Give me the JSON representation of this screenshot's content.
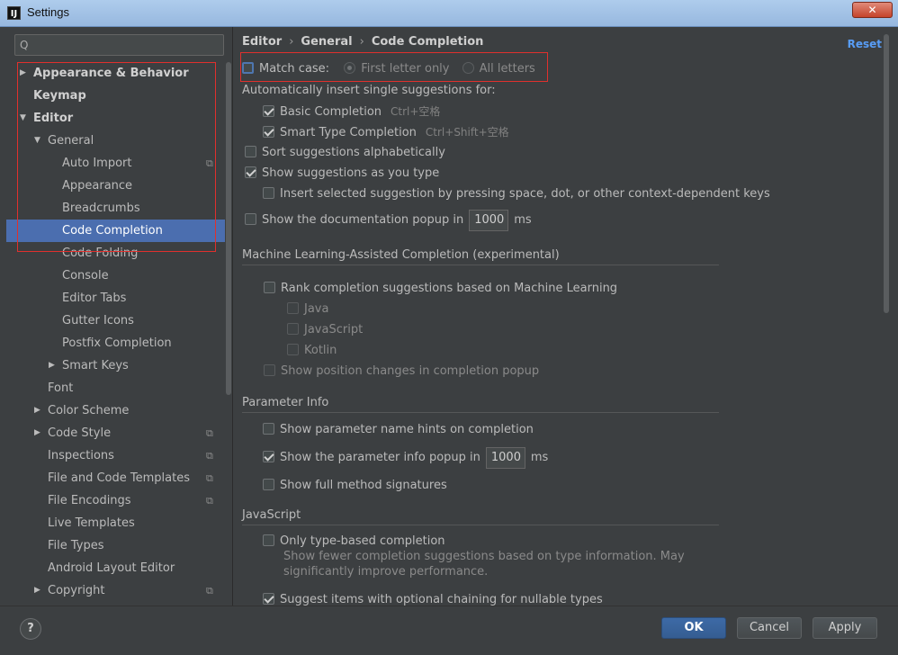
{
  "window": {
    "title": "Settings",
    "app_icon": "IJ",
    "close_glyph": "✕"
  },
  "search": {
    "placeholder": "",
    "icon": "Q"
  },
  "tree": [
    {
      "label": "Appearance & Behavior",
      "depth": 0,
      "arrow": "▶",
      "bold": true
    },
    {
      "label": "Keymap",
      "depth": 0,
      "bold": true
    },
    {
      "label": "Editor",
      "depth": 0,
      "arrow": "▼",
      "bold": true
    },
    {
      "label": "General",
      "depth": 1,
      "arrow": "▼"
    },
    {
      "label": "Auto Import",
      "depth": 2,
      "copy": true
    },
    {
      "label": "Appearance",
      "depth": 2
    },
    {
      "label": "Breadcrumbs",
      "depth": 2
    },
    {
      "label": "Code Completion",
      "depth": 2,
      "selected": true
    },
    {
      "label": "Code Folding",
      "depth": 2
    },
    {
      "label": "Console",
      "depth": 2
    },
    {
      "label": "Editor Tabs",
      "depth": 2
    },
    {
      "label": "Gutter Icons",
      "depth": 2
    },
    {
      "label": "Postfix Completion",
      "depth": 2
    },
    {
      "label": "Smart Keys",
      "depth": 2,
      "arrow": "▶"
    },
    {
      "label": "Font",
      "depth": 1
    },
    {
      "label": "Color Scheme",
      "depth": 1,
      "arrow": "▶"
    },
    {
      "label": "Code Style",
      "depth": 1,
      "arrow": "▶",
      "copy": true
    },
    {
      "label": "Inspections",
      "depth": 1,
      "copy": true
    },
    {
      "label": "File and Code Templates",
      "depth": 1,
      "copy": true
    },
    {
      "label": "File Encodings",
      "depth": 1,
      "copy": true
    },
    {
      "label": "Live Templates",
      "depth": 1
    },
    {
      "label": "File Types",
      "depth": 1
    },
    {
      "label": "Android Layout Editor",
      "depth": 1
    },
    {
      "label": "Copyright",
      "depth": 1,
      "arrow": "▶",
      "copy": true
    }
  ],
  "breadcrumb": {
    "part1": "Editor",
    "part2": "General",
    "part3": "Code Completion",
    "sep": "›"
  },
  "reset_label": "Reset",
  "match_case": {
    "label": "Match case:",
    "checked": false,
    "option1": "First letter only",
    "option2": "All letters"
  },
  "auto_insert": {
    "heading": "Automatically insert single suggestions for:",
    "basic": {
      "label": "Basic Completion",
      "shortcut": "Ctrl+空格",
      "checked": true
    },
    "smart": {
      "label": "Smart Type Completion",
      "shortcut": "Ctrl+Shift+空格",
      "checked": true
    }
  },
  "options": {
    "sort_alpha": {
      "label": "Sort suggestions alphabetically",
      "checked": false
    },
    "show_as_type": {
      "label": "Show suggestions as you type",
      "checked": true
    },
    "insert_selected": {
      "label": "Insert selected suggestion by pressing space, dot, or other context-dependent keys",
      "checked": false
    },
    "doc_popup": {
      "label": "Show the documentation popup in",
      "value": "1000",
      "unit": "ms",
      "checked": false
    }
  },
  "ml_section": {
    "heading": "Machine Learning-Assisted Completion (experimental)",
    "rank": "Rank completion suggestions based on Machine Learning",
    "java": "Java",
    "javascript": "JavaScript",
    "kotlin": "Kotlin",
    "position_changes": "Show position changes in completion popup"
  },
  "param_section": {
    "heading": "Parameter Info",
    "name_hints": "Show parameter name hints on completion",
    "info_popup": {
      "label": "Show the parameter info popup in",
      "value": "1000",
      "unit": "ms"
    },
    "full_sig": "Show full method signatures"
  },
  "js_section": {
    "heading": "JavaScript",
    "type_based": "Only type-based completion",
    "desc_line1": "Show fewer completion suggestions based on type information. May",
    "desc_line2": "significantly improve performance.",
    "chaining": "Suggest items with optional chaining for nullable types"
  },
  "footer": {
    "help": "?",
    "ok": "OK",
    "cancel": "Cancel",
    "apply": "Apply"
  },
  "colors": {
    "selection": "#4b6eaf",
    "annotation": "#e0302d",
    "link": "#589df6"
  }
}
